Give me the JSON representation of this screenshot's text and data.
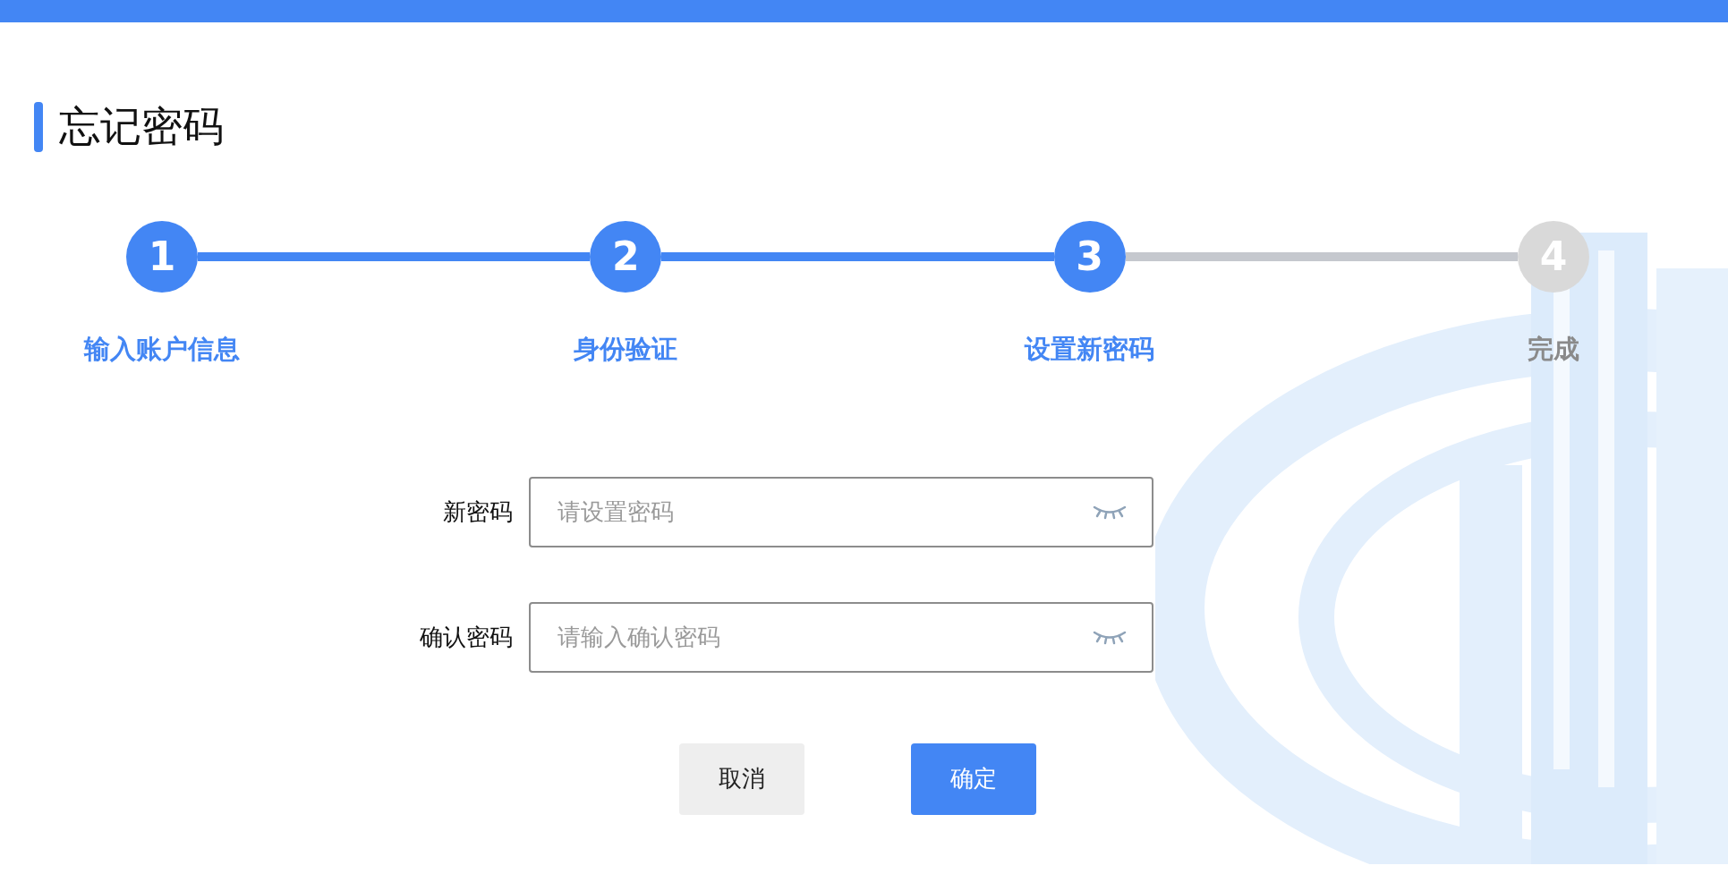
{
  "page_title": "忘记密码",
  "steps": [
    {
      "number": "1",
      "label": "输入账户信息",
      "active": true
    },
    {
      "number": "2",
      "label": "身份验证",
      "active": true
    },
    {
      "number": "3",
      "label": "设置新密码",
      "active": true
    },
    {
      "number": "4",
      "label": "完成",
      "active": false
    }
  ],
  "fields": [
    {
      "label": "新密码",
      "placeholder": "请设置密码"
    },
    {
      "label": "确认密码",
      "placeholder": "请输入确认密码"
    }
  ],
  "buttons": [
    {
      "label": "取消",
      "kind": "secondary"
    },
    {
      "label": "确定",
      "kind": "primary"
    }
  ]
}
